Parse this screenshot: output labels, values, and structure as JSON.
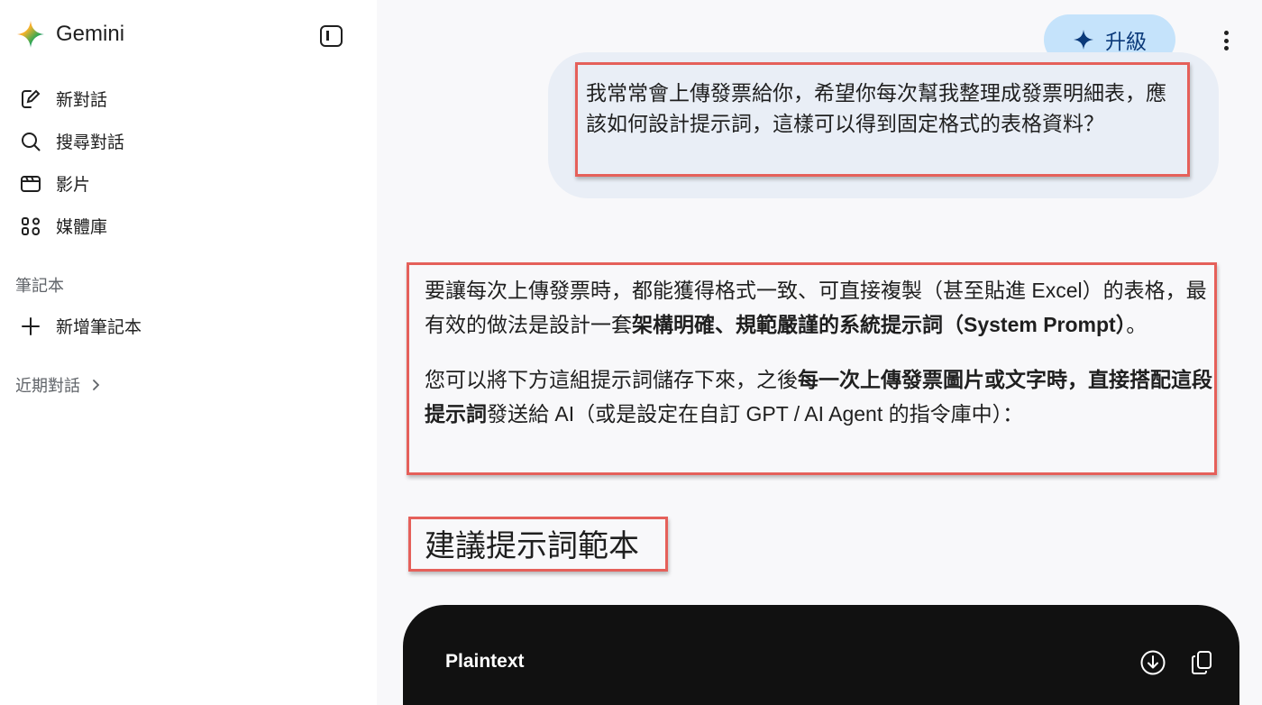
{
  "sidebar": {
    "brand": "Gemini",
    "nav_items": [
      {
        "label": "新對話",
        "icon": "edit-icon"
      },
      {
        "label": "搜尋對話",
        "icon": "search-icon"
      },
      {
        "label": "影片",
        "icon": "video-icon"
      },
      {
        "label": "媒體庫",
        "icon": "library-icon"
      }
    ],
    "notebook_section": "筆記本",
    "new_notebook": "新增筆記本",
    "recent_section": "近期對話"
  },
  "header": {
    "upgrade_label": "升級"
  },
  "chat": {
    "user_message": "我常常會上傳發票給你，希望你每次幫我整理成發票明細表，應該如何設計提示詞，這樣可以得到固定格式的表格資料？",
    "answer_p1_a": "要讓每次上傳發票時，都能獲得格式一致、可直接複製（甚至貼進 Excel）的表格，最有效的做法是設計一套",
    "answer_p1_bold": "架構明確、規範嚴謹的系統提示詞（System Prompt）",
    "answer_p1_b": "。",
    "answer_p2_a": "您可以將下方這組提示詞儲存下來，之後",
    "answer_p2_bold": "每一次上傳發票圖片或文字時，直接搭配這段提示詞",
    "answer_p2_b": "發送給 AI（或是設定在自訂 GPT / AI Agent 的指令庫中）：",
    "heading": "建議提示詞範本",
    "code_lang": "Plaintext"
  },
  "colors": {
    "highlight_border": "#e5605a",
    "user_bubble": "#e9eef6",
    "upgrade_bg": "#c5e3fb",
    "code_bg": "#111111"
  }
}
